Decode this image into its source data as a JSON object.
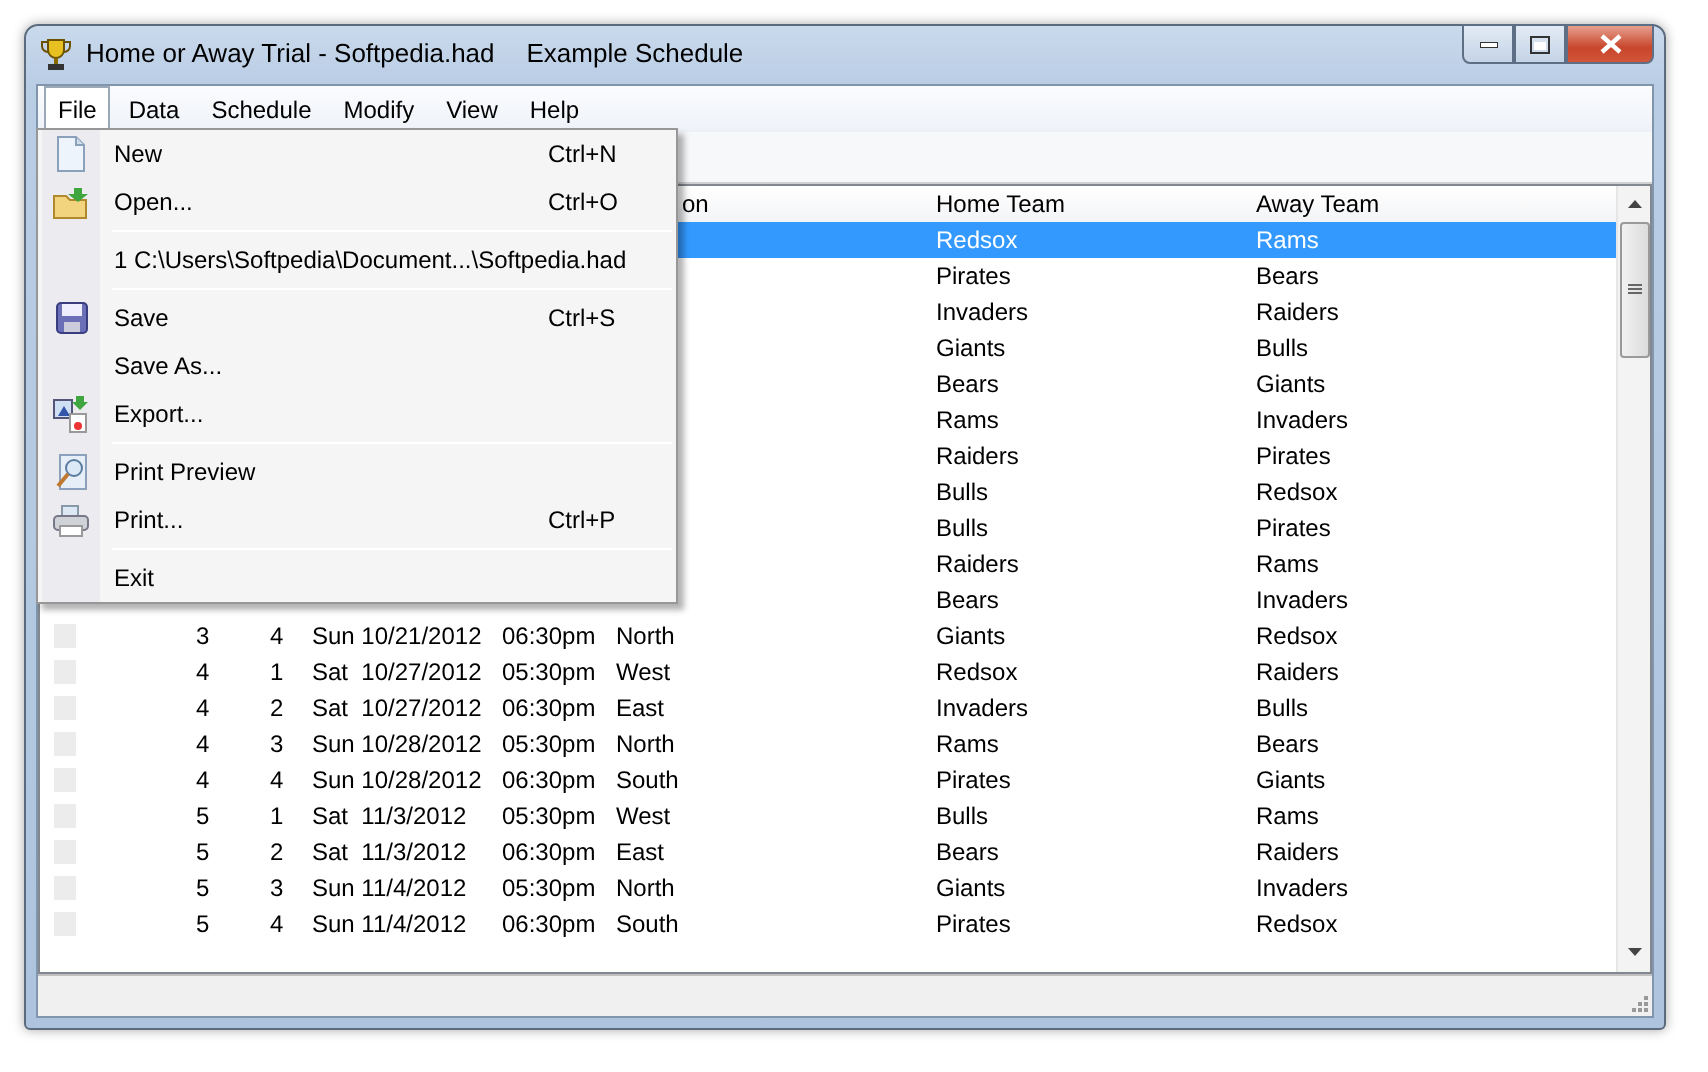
{
  "window": {
    "title": "Home or Away Trial - Softpedia.had",
    "document": "Example Schedule"
  },
  "menubar": [
    {
      "label": "File",
      "selected": true
    },
    {
      "label": "Data",
      "selected": false
    },
    {
      "label": "Schedule",
      "selected": false
    },
    {
      "label": "Modify",
      "selected": false
    },
    {
      "label": "View",
      "selected": false
    },
    {
      "label": "Help",
      "selected": false
    }
  ],
  "file_menu": [
    {
      "kind": "item",
      "label": "New",
      "shortcut": "Ctrl+N"
    },
    {
      "kind": "item",
      "label": "Open...",
      "shortcut": "Ctrl+O"
    },
    {
      "kind": "separator"
    },
    {
      "kind": "item",
      "label": "1 C:\\Users\\Softpedia\\Document...\\Softpedia.had"
    },
    {
      "kind": "separator"
    },
    {
      "kind": "item",
      "label": "Save",
      "shortcut": "Ctrl+S"
    },
    {
      "kind": "item",
      "label": "Save As..."
    },
    {
      "kind": "item",
      "label": "Export..."
    },
    {
      "kind": "separator"
    },
    {
      "kind": "item",
      "label": "Print Preview"
    },
    {
      "kind": "item",
      "label": "Print...",
      "shortcut": "Ctrl+P"
    },
    {
      "kind": "separator"
    },
    {
      "kind": "item",
      "label": "Exit"
    }
  ],
  "table": {
    "header": [
      "on",
      "Home Team",
      "Away Team"
    ],
    "rows": [
      {
        "selected": true,
        "home": "Redsox",
        "away": "Rams"
      },
      {
        "selected": false,
        "home": "Pirates",
        "away": "Bears"
      },
      {
        "selected": false,
        "home": "Invaders",
        "away": "Raiders"
      },
      {
        "selected": false,
        "home": "Giants",
        "away": "Bulls"
      },
      {
        "selected": false,
        "home": "Bears",
        "away": "Giants"
      },
      {
        "selected": false,
        "home": "Rams",
        "away": "Invaders"
      },
      {
        "selected": false,
        "home": "Raiders",
        "away": "Pirates"
      },
      {
        "selected": false,
        "home": "Bulls",
        "away": "Redsox"
      },
      {
        "selected": false,
        "home": "Bulls",
        "away": "Pirates"
      },
      {
        "selected": false,
        "home": "Raiders",
        "away": "Rams"
      },
      {
        "selected": false,
        "home": "Bears",
        "away": "Invaders"
      },
      {
        "selected": false,
        "week": "3",
        "game": "4",
        "date": "Sun 10/21/2012",
        "time": "06:30pm",
        "location": "North",
        "home": "Giants",
        "away": "Redsox"
      },
      {
        "selected": false,
        "week": "4",
        "game": "1",
        "date": "Sat  10/27/2012",
        "time": "05:30pm",
        "location": "West",
        "home": "Redsox",
        "away": "Raiders"
      },
      {
        "selected": false,
        "week": "4",
        "game": "2",
        "date": "Sat  10/27/2012",
        "time": "06:30pm",
        "location": "East",
        "home": "Invaders",
        "away": "Bulls"
      },
      {
        "selected": false,
        "week": "4",
        "game": "3",
        "date": "Sun 10/28/2012",
        "time": "05:30pm",
        "location": "North",
        "home": "Rams",
        "away": "Bears"
      },
      {
        "selected": false,
        "week": "4",
        "game": "4",
        "date": "Sun 10/28/2012",
        "time": "06:30pm",
        "location": "South",
        "home": "Pirates",
        "away": "Giants"
      },
      {
        "selected": false,
        "week": "5",
        "game": "1",
        "date": "Sat  11/3/2012",
        "time": "05:30pm",
        "location": "West",
        "home": "Bulls",
        "away": "Rams"
      },
      {
        "selected": false,
        "week": "5",
        "game": "2",
        "date": "Sat  11/3/2012",
        "time": "06:30pm",
        "location": "East",
        "home": "Bears",
        "away": "Raiders"
      },
      {
        "selected": false,
        "week": "5",
        "game": "3",
        "date": "Sun 11/4/2012",
        "time": "05:30pm",
        "location": "North",
        "home": "Giants",
        "away": "Invaders"
      },
      {
        "selected": false,
        "week": "5",
        "game": "4",
        "date": "Sun 11/4/2012",
        "time": "06:30pm",
        "location": "South",
        "home": "Pirates",
        "away": "Redsox"
      }
    ]
  }
}
